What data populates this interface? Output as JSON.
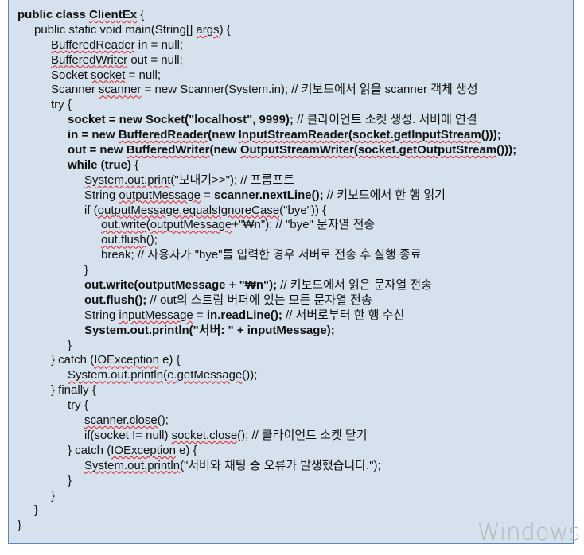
{
  "watermark": "Windows",
  "lines": [
    {
      "indent": 0,
      "segs": [
        {
          "t": "public class ",
          "b": true
        },
        {
          "t": "ClientEx",
          "b": true,
          "s": true
        },
        {
          "t": " {"
        }
      ]
    },
    {
      "indent": 1,
      "segs": [
        {
          "t": "public static void main(String[] "
        },
        {
          "t": "args",
          "s": true
        },
        {
          "t": ") {"
        }
      ]
    },
    {
      "indent": 2,
      "segs": [
        {
          "t": "BufferedReader",
          "s": true
        },
        {
          "t": " in = null;"
        }
      ]
    },
    {
      "indent": 2,
      "segs": [
        {
          "t": "BufferedWriter",
          "s": true
        },
        {
          "t": " out = null;"
        }
      ]
    },
    {
      "indent": 2,
      "segs": [
        {
          "t": "Socket "
        },
        {
          "t": "socket",
          "s": true
        },
        {
          "t": " = null;"
        }
      ]
    },
    {
      "indent": 2,
      "segs": [
        {
          "t": "Scanner "
        },
        {
          "t": "scanner",
          "s": true
        },
        {
          "t": " = new Scanner(System.in); // 키보드에서 읽을 scanner 객체 생성"
        }
      ]
    },
    {
      "indent": 2,
      "segs": [
        {
          "t": "try {"
        }
      ]
    },
    {
      "indent": 3,
      "segs": [
        {
          "t": "socket = new Socket(\"localhost\", 9999);",
          "b": true
        },
        {
          "t": " // 클라이언트 소켓 생성. 서버에 연결"
        }
      ]
    },
    {
      "indent": 3,
      "segs": [
        {
          "t": "in = new ",
          "b": true
        },
        {
          "t": "BufferedReader",
          "b": true,
          "s": true
        },
        {
          "t": "(new ",
          "b": true
        },
        {
          "t": "InputStreamReader(socket.getInputStream",
          "b": true,
          "s": true
        },
        {
          "t": "()));",
          "b": true
        }
      ]
    },
    {
      "indent": 3,
      "segs": [
        {
          "t": "out = new ",
          "b": true
        },
        {
          "t": "BufferedWriter",
          "b": true,
          "s": true
        },
        {
          "t": "(new ",
          "b": true
        },
        {
          "t": "OutputStreamWriter(socket.getOutputStream",
          "b": true,
          "s": true
        },
        {
          "t": "()));",
          "b": true
        }
      ]
    },
    {
      "indent": 3,
      "segs": [
        {
          "t": "while (true)",
          "b": true
        },
        {
          "t": " {"
        }
      ]
    },
    {
      "indent": 4,
      "segs": [
        {
          "t": "System.out.print",
          "s": true
        },
        {
          "t": "(\"보내기>>\"); // 프롬프트"
        }
      ]
    },
    {
      "indent": 4,
      "segs": [
        {
          "t": "String "
        },
        {
          "t": "outputMessage",
          "s": true
        },
        {
          "t": " = "
        },
        {
          "t": "scanner.nextLine();",
          "b": true
        },
        {
          "t": " // 키보드에서 한 행 읽기"
        }
      ]
    },
    {
      "indent": 4,
      "segs": [
        {
          "t": "if ("
        },
        {
          "t": "outputMessage.equalsIgnoreCase",
          "s": true
        },
        {
          "t": "(\"bye\")) {"
        }
      ]
    },
    {
      "indent": 5,
      "segs": [
        {
          "t": "out.write",
          "s": true
        },
        {
          "t": "("
        },
        {
          "t": "outputMessage",
          "s": true
        },
        {
          "t": "+\"₩n\"); // \"bye\" 문자열 전송"
        }
      ]
    },
    {
      "indent": 5,
      "segs": [
        {
          "t": "out.flush",
          "s": true
        },
        {
          "t": "();"
        }
      ]
    },
    {
      "indent": 5,
      "segs": [
        {
          "t": "break; // 사용자가 \"bye\"를 입력한 경우 서버로 전송 후 실행 종료"
        }
      ]
    },
    {
      "indent": 4,
      "segs": [
        {
          "t": "}"
        }
      ]
    },
    {
      "indent": 4,
      "segs": [
        {
          "t": "out.write(outputMessage + \"₩n\");",
          "b": true
        },
        {
          "t": " // 키보드에서 읽은 문자열 전송"
        }
      ]
    },
    {
      "indent": 4,
      "segs": [
        {
          "t": "out.flush();",
          "b": true
        },
        {
          "t": " // out의 스트림 버퍼에 있는 모든 문자열 전송"
        }
      ]
    },
    {
      "indent": 4,
      "segs": [
        {
          "t": "String "
        },
        {
          "t": "inputMessage",
          "s": true
        },
        {
          "t": " = "
        },
        {
          "t": "in.readLine();",
          "b": true
        },
        {
          "t": " // 서버로부터 한 행 수신"
        }
      ]
    },
    {
      "indent": 4,
      "segs": [
        {
          "t": "System.out.println(\"서버: \" + inputMessage);",
          "b": true
        }
      ]
    },
    {
      "indent": 3,
      "segs": [
        {
          "t": "}"
        }
      ]
    },
    {
      "indent": 2,
      "segs": [
        {
          "t": "} catch ("
        },
        {
          "t": "IOException",
          "s": true
        },
        {
          "t": " e) {"
        }
      ]
    },
    {
      "indent": 3,
      "segs": [
        {
          "t": "System.out.println",
          "s": true
        },
        {
          "t": "("
        },
        {
          "t": "e.getMessage",
          "s": true
        },
        {
          "t": "());"
        }
      ]
    },
    {
      "indent": 2,
      "segs": [
        {
          "t": "} finally {"
        }
      ]
    },
    {
      "indent": 3,
      "segs": [
        {
          "t": "try {"
        }
      ]
    },
    {
      "indent": 4,
      "segs": [
        {
          "t": "scanner.close",
          "s": true
        },
        {
          "t": "();"
        }
      ]
    },
    {
      "indent": 4,
      "segs": [
        {
          "t": "if(socket != null) "
        },
        {
          "t": "socket.close",
          "s": true
        },
        {
          "t": "(); // 클라이언트 소켓 닫기"
        }
      ]
    },
    {
      "indent": 3,
      "segs": [
        {
          "t": "} catch ("
        },
        {
          "t": "IOException",
          "s": true
        },
        {
          "t": " e) {"
        }
      ]
    },
    {
      "indent": 4,
      "segs": [
        {
          "t": "System.out.println",
          "s": true
        },
        {
          "t": "(\"서버와 채팅 중 오류가 발생했습니다.\");"
        }
      ]
    },
    {
      "indent": 3,
      "segs": [
        {
          "t": "}"
        }
      ]
    },
    {
      "indent": 2,
      "segs": [
        {
          "t": "}"
        }
      ]
    },
    {
      "indent": 1,
      "segs": [
        {
          "t": "}"
        }
      ]
    },
    {
      "indent": 0,
      "segs": [
        {
          "t": "}"
        }
      ]
    }
  ]
}
